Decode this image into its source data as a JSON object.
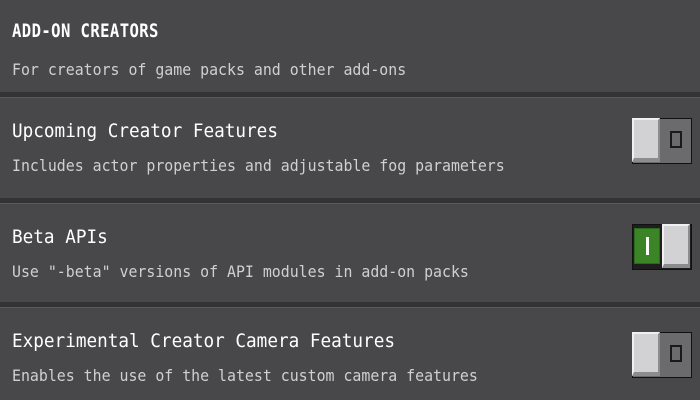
{
  "section": {
    "title": "ADD-ON CREATORS",
    "subtitle": "For creators of game packs and other add-ons"
  },
  "settings": [
    {
      "title": "Upcoming Creator Features",
      "description": "Includes actor properties and adjustable fog parameters",
      "enabled": false
    },
    {
      "title": "Beta APIs",
      "description": "Use \"-beta\" versions of API modules in add-on packs",
      "enabled": true
    },
    {
      "title": "Experimental Creator Camera Features",
      "description": "Enables the use of the latest custom camera features",
      "enabled": false
    }
  ],
  "colors": {
    "background": "#48484a",
    "divider": "#333335",
    "toggle_on": "#3c8527",
    "toggle_off": "#6b6b6d"
  }
}
